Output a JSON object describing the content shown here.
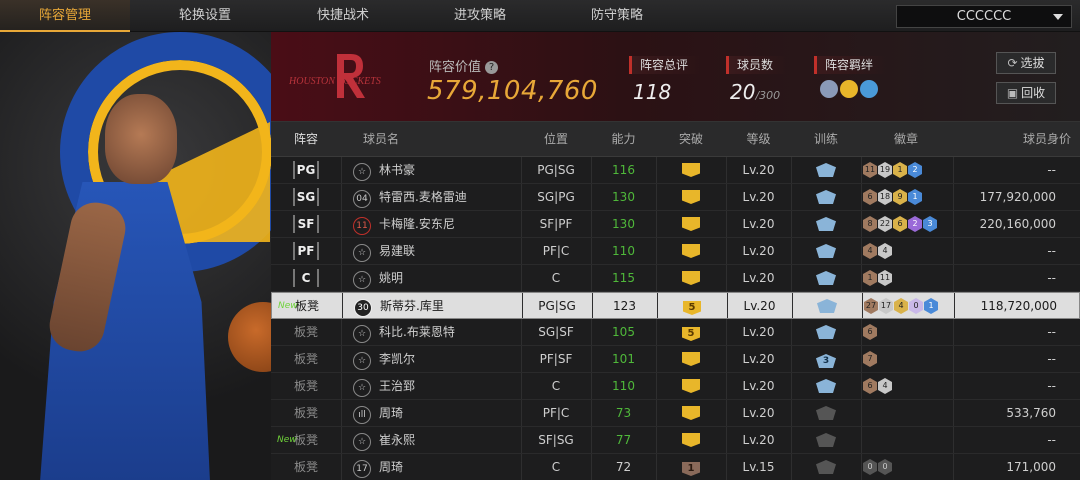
{
  "nav": {
    "tabs": [
      "阵容管理",
      "轮换设置",
      "快捷战术",
      "进攻策略",
      "防守策略"
    ],
    "active_tab": 0,
    "team_select": "CCCCCC"
  },
  "summary": {
    "team_logo_text": "HOUSTON ROCKETS",
    "value_label": "阵容价值",
    "value": "579,104,760",
    "rating_label": "阵容总评",
    "rating": "118",
    "count_label": "球员数",
    "count": "20",
    "count_max": "/300",
    "bond_label": "阵容羁绊",
    "pick_button": "选拔",
    "recycle_button": "回收"
  },
  "table": {
    "headers": [
      "阵容",
      "球员名",
      "位置",
      "能力",
      "突破",
      "等级",
      "训练",
      "徽章",
      "球员身价"
    ],
    "rows": [
      {
        "slot": "PG",
        "new": "",
        "num": "☆",
        "name": "林书豪",
        "pos": "PG|SG",
        "ability": "116",
        "breach": "",
        "level": "Lv.20",
        "train": "",
        "badges": [
          "11",
          "19",
          "1",
          "2"
        ],
        "value": "--"
      },
      {
        "slot": "SG",
        "new": "",
        "num": "04",
        "name": "特雷西.麦格雷迪",
        "pos": "SG|PG",
        "ability": "130",
        "breach": "",
        "level": "Lv.20",
        "train": "",
        "badges": [
          "6",
          "18",
          "9",
          "1"
        ],
        "value": "177,920,000"
      },
      {
        "slot": "SF",
        "new": "",
        "num": "11",
        "name": "卡梅隆.安东尼",
        "pos": "SF|PF",
        "ability": "130",
        "breach": "",
        "level": "Lv.20",
        "train": "",
        "badges": [
          "8",
          "22",
          "6",
          "2",
          "3"
        ],
        "value": "220,160,000"
      },
      {
        "slot": "PF",
        "new": "",
        "num": "☆",
        "name": "易建联",
        "pos": "PF|C",
        "ability": "110",
        "breach": "",
        "level": "Lv.20",
        "train": "",
        "badges": [
          "4",
          "4"
        ],
        "value": "--"
      },
      {
        "slot": "C",
        "new": "",
        "num": "☆",
        "name": "姚明",
        "pos": "C",
        "ability": "115",
        "breach": "",
        "level": "Lv.20",
        "train": "",
        "badges": [
          "1",
          "11"
        ],
        "value": "--"
      },
      {
        "slot": "板凳",
        "new": "New",
        "num": "30",
        "name": "斯蒂芬.库里",
        "pos": "PG|SG",
        "ability": "123",
        "breach": "5",
        "level": "Lv.20",
        "train": "",
        "badges": [
          "27",
          "17",
          "4",
          "0",
          "1"
        ],
        "value": "118,720,000"
      },
      {
        "slot": "板凳",
        "new": "",
        "num": "☆",
        "name": "科比.布莱恩特",
        "pos": "SG|SF",
        "ability": "105",
        "breach": "5",
        "level": "Lv.20",
        "train": "",
        "badges": [
          "6"
        ],
        "value": "--"
      },
      {
        "slot": "板凳",
        "new": "",
        "num": "☆",
        "name": "李凯尔",
        "pos": "PF|SF",
        "ability": "101",
        "breach": "",
        "level": "Lv.20",
        "train": "3",
        "badges": [
          "7"
        ],
        "value": "--"
      },
      {
        "slot": "板凳",
        "new": "",
        "num": "☆",
        "name": "王治郅",
        "pos": "C",
        "ability": "110",
        "breach": "",
        "level": "Lv.20",
        "train": "",
        "badges": [
          "6",
          "4"
        ],
        "value": "--"
      },
      {
        "slot": "板凳",
        "new": "",
        "num": "ıll",
        "name": "周琦",
        "pos": "PF|C",
        "ability": "73",
        "breach": "",
        "level": "Lv.20",
        "train": "",
        "badges": [],
        "value": "533,760"
      },
      {
        "slot": "板凳",
        "new": "New",
        "num": "☆",
        "name": "崔永熙",
        "pos": "SF|SG",
        "ability": "77",
        "breach": "",
        "level": "Lv.20",
        "train": "",
        "badges": [],
        "value": "--"
      },
      {
        "slot": "板凳",
        "new": "",
        "num": "17",
        "name": "周琦",
        "pos": "C",
        "ability": "72",
        "breach": "1",
        "level": "Lv.15",
        "train": "",
        "badges": [
          "0",
          "0"
        ],
        "value": "171,000"
      }
    ]
  },
  "colors": {
    "accent": "#e8a838",
    "ability_green": "#4fb83a",
    "selected_row_bg": "#dedede"
  }
}
